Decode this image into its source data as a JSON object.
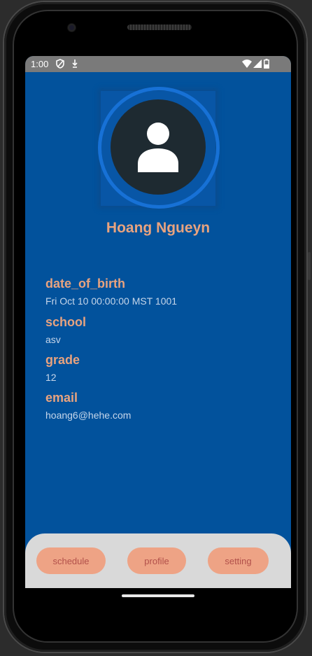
{
  "status_bar": {
    "time": "1:00",
    "icons": [
      "shield-icon",
      "download-icon",
      "wifi-icon",
      "signal-icon",
      "battery-icon"
    ]
  },
  "profile": {
    "name": "Hoang Ngueyn",
    "avatar_icon": "person-icon"
  },
  "fields": [
    {
      "label": "date_of_birth",
      "value": "Fri Oct 10 00:00:00 MST 1001"
    },
    {
      "label": "school",
      "value": "asv"
    },
    {
      "label": "grade",
      "value": "12"
    },
    {
      "label": "email",
      "value": "hoang6@hehe.com"
    }
  ],
  "nav": {
    "schedule_label": "schedule",
    "profile_label": "profile",
    "setting_label": "setting"
  },
  "colors": {
    "background": "#02529c",
    "accent_text": "#e8a37f",
    "button_bg": "#eea385",
    "button_text": "#b2504a",
    "nav_bg": "#d9d9d9"
  }
}
